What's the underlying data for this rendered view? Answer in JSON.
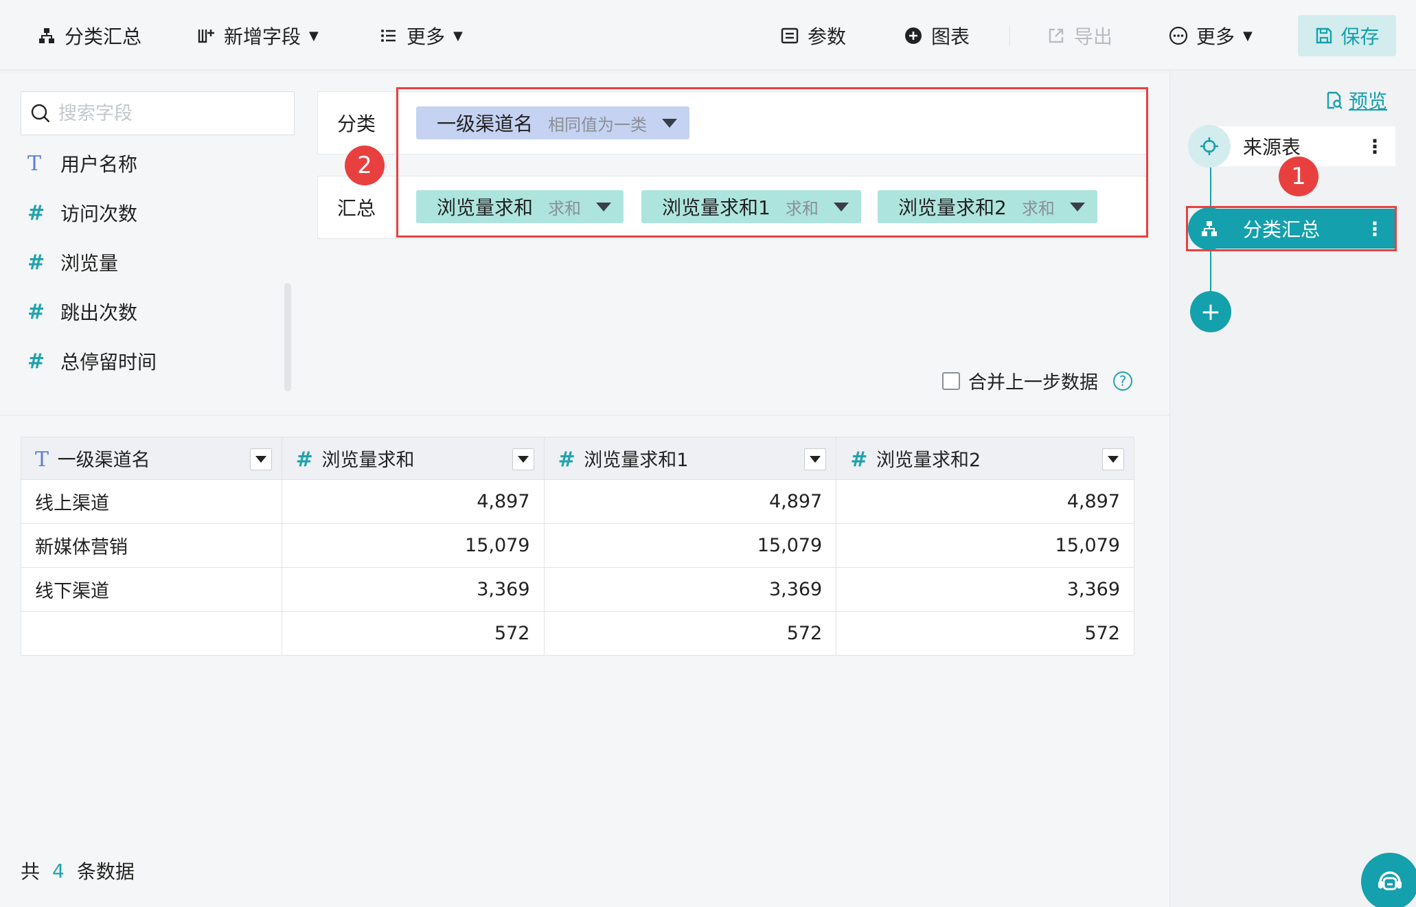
{
  "toolbar": {
    "group_summary": "分类汇总",
    "add_field": "新增字段",
    "more_left": "更多",
    "params": "参数",
    "chart": "图表",
    "export": "导出",
    "more_right": "更多",
    "save": "保存"
  },
  "fields": {
    "search_placeholder": "搜索字段",
    "items": [
      {
        "type": "T",
        "name": "用户名称"
      },
      {
        "type": "#",
        "name": "访问次数"
      },
      {
        "type": "#",
        "name": "浏览量"
      },
      {
        "type": "#",
        "name": "跳出次数"
      },
      {
        "type": "#",
        "name": "总停留时间"
      }
    ]
  },
  "config": {
    "group_label": "分类",
    "summary_label": "汇总",
    "group_chip": {
      "name": "一级渠道名",
      "mode": "相同值为一类"
    },
    "summary_chips": [
      {
        "name": "浏览量求和",
        "mode": "求和"
      },
      {
        "name": "浏览量求和1",
        "mode": "求和"
      },
      {
        "name": "浏览量求和2",
        "mode": "求和"
      }
    ],
    "merge_label": "合并上一步数据",
    "help": "?"
  },
  "badges": {
    "one": "1",
    "two": "2"
  },
  "table": {
    "headers": [
      {
        "type": "T",
        "name": "一级渠道名"
      },
      {
        "type": "#",
        "name": "浏览量求和"
      },
      {
        "type": "#",
        "name": "浏览量求和1"
      },
      {
        "type": "#",
        "name": "浏览量求和2"
      }
    ],
    "rows": [
      [
        "线上渠道",
        "4,897",
        "4,897",
        "4,897"
      ],
      [
        "新媒体营销",
        "15,079",
        "15,079",
        "15,079"
      ],
      [
        "线下渠道",
        "3,369",
        "3,369",
        "3,369"
      ],
      [
        "",
        "572",
        "572",
        "572"
      ]
    ]
  },
  "footer": {
    "prefix": "共",
    "count": "4",
    "suffix": "条数据"
  },
  "steps": {
    "preview": "预览",
    "source": "来源表",
    "current": "分类汇总",
    "menu": "⋮",
    "add": "+"
  },
  "colors": {
    "accent": "#14a0ac",
    "highlight": "#e8403f",
    "chip_blue": "#c5d2f1",
    "chip_teal": "#ade4de"
  }
}
